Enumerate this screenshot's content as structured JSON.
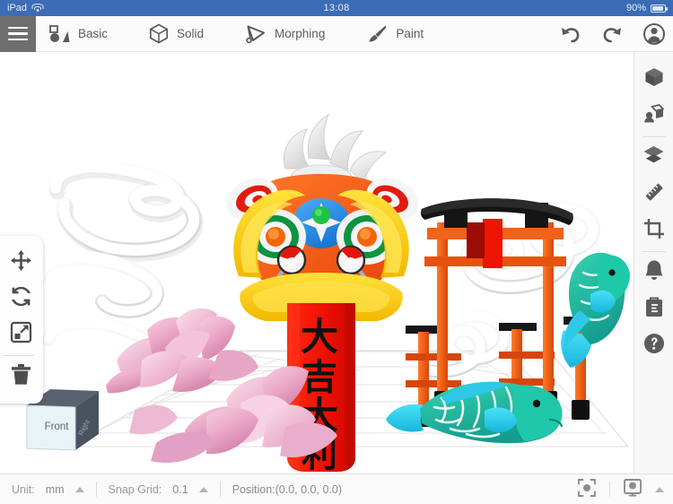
{
  "status_bar": {
    "carrier": "iPad",
    "wifi_icon": "wifi-icon",
    "time": "13:08",
    "battery_percent": "90%",
    "battery_icon": "battery-icon"
  },
  "toolbar": {
    "menu_icon": "hamburger-menu-icon",
    "items": [
      {
        "label": "Basic",
        "icon": "basic-shapes-icon"
      },
      {
        "label": "Solid",
        "icon": "cube-solid-icon"
      },
      {
        "label": "Morphing",
        "icon": "morphing-deform-icon"
      },
      {
        "label": "Paint",
        "icon": "paint-brush-icon"
      }
    ],
    "undo_icon": "undo-arrow-icon",
    "redo_icon": "redo-arrow-icon",
    "account_icon": "user-account-icon"
  },
  "left_tools": [
    {
      "name": "move-tool",
      "icon": "move-arrows-icon"
    },
    {
      "name": "rotate-tool",
      "icon": "rotate-refresh-icon"
    },
    {
      "name": "scale-tool",
      "icon": "scale-resize-icon"
    },
    {
      "name": "delete-tool",
      "icon": "trash-icon"
    }
  ],
  "sidebar": {
    "items": [
      {
        "name": "shapes-panel",
        "icon": "cube-icon"
      },
      {
        "name": "import-panel",
        "icon": "import-object-icon"
      },
      {
        "name": "layers-panel",
        "icon": "layers-icon"
      },
      {
        "name": "measure-panel",
        "icon": "ruler-icon"
      },
      {
        "name": "crop-panel",
        "icon": "crop-icon"
      },
      {
        "name": "notifications",
        "icon": "bell-icon"
      },
      {
        "name": "library-panel",
        "icon": "case-briefcase-icon"
      },
      {
        "name": "help-panel",
        "icon": "question-help-icon"
      }
    ]
  },
  "bottom_bar": {
    "unit_label": "Unit:",
    "unit_value": "mm",
    "snap_label": "Snap Grid:",
    "snap_value": "0.1",
    "position_text": "Position:(0.0, 0.0, 0.0)",
    "focus_icon": "focus-center-icon",
    "display_icon": "display-mode-icon",
    "display_caret_icon": "caret-up-icon"
  },
  "viewcube": {
    "face_label": "Front",
    "name": "view-orientation-cube"
  },
  "scene": {
    "name": "3d-viewport",
    "banner_text": "大吉大利",
    "objects": [
      "lion-dance-head",
      "red-banner-scroll",
      "torii-gate",
      "lotus-flowers",
      "koi-fish-front",
      "koi-fish-back",
      "cloud-swirls",
      "ground-grid"
    ],
    "colors": {
      "lion_orange": "#f4581b",
      "lion_yellow": "#ffd500",
      "banner_red": "#f01405",
      "torii_orange": "#ef6615",
      "torii_black": "#1b1b1b",
      "lotus_pink": "#eaa2c3",
      "koi_teal": "#23b9a5",
      "koi_cyan": "#28d2ef",
      "cloud_white": "#f4f4f4",
      "grid_line": "#d6d6d6",
      "accent_blue": "#2196f3"
    }
  }
}
